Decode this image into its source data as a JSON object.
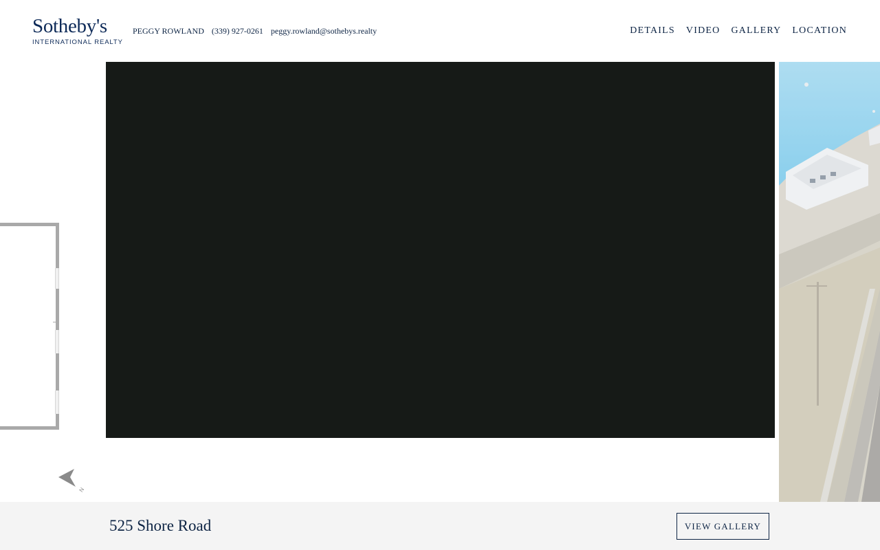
{
  "brand": {
    "name": "Sotheby's",
    "subtitle": "INTERNATIONAL REALTY"
  },
  "agent": {
    "name": "PEGGY ROWLAND",
    "phone": "(339) 927-0261",
    "email": "peggy.rowland@sothebys.realty"
  },
  "nav": {
    "items": [
      {
        "label": "DETAILS"
      },
      {
        "label": "VIDEO"
      },
      {
        "label": "GALLERY"
      },
      {
        "label": "LOCATION"
      }
    ]
  },
  "floorplan": {
    "compass_label": "N"
  },
  "footer": {
    "address": "525 Shore Road",
    "gallery_button": "VIEW GALLERY"
  },
  "colors": {
    "brand_navy": "#0d2a58",
    "text_navy": "#0d2444",
    "video_bg": "#161a17",
    "footer_bg": "#f4f4f4",
    "floorplan_wall": "#a9a9a9"
  }
}
